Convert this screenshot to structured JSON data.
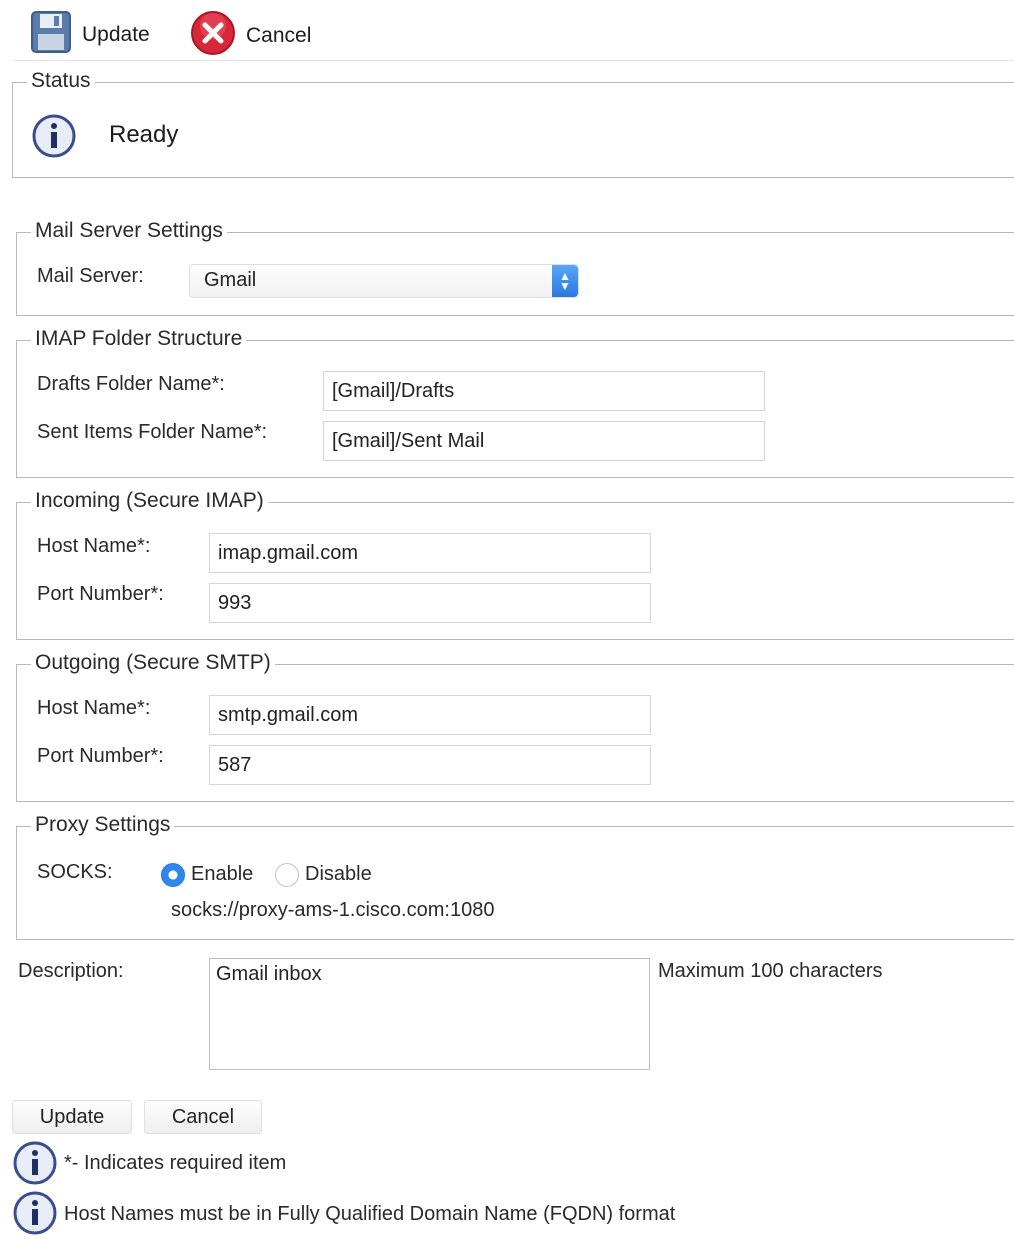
{
  "toolbar": {
    "update_label": "Update",
    "cancel_label": "Cancel"
  },
  "status": {
    "legend": "Status",
    "text": "Ready"
  },
  "mail_server_settings": {
    "legend": "Mail Server Settings",
    "mail_server_label": "Mail Server:",
    "mail_server_value": "Gmail"
  },
  "imap_folder_structure": {
    "legend": "IMAP Folder Structure",
    "drafts_label": "Drafts Folder Name*:",
    "drafts_value": "[Gmail]/Drafts",
    "sent_label": "Sent Items Folder Name*:",
    "sent_value": "[Gmail]/Sent Mail"
  },
  "incoming": {
    "legend": "Incoming (Secure IMAP)",
    "host_label": "Host Name*:",
    "host_value": "imap.gmail.com",
    "port_label": "Port Number*:",
    "port_value": "993"
  },
  "outgoing": {
    "legend": "Outgoing (Secure SMTP)",
    "host_label": "Host Name*:",
    "host_value": "smtp.gmail.com",
    "port_label": "Port Number*:",
    "port_value": "587"
  },
  "proxy": {
    "legend": "Proxy Settings",
    "socks_label": "SOCKS:",
    "enable_label": "Enable",
    "disable_label": "Disable",
    "selected": "Enable",
    "proxy_url": "socks://proxy-ams-1.cisco.com:1080"
  },
  "description": {
    "label": "Description:",
    "value": "Gmail inbox",
    "hint": "Maximum 100 characters"
  },
  "bottom_buttons": {
    "update_label": "Update",
    "cancel_label": "Cancel"
  },
  "notes": {
    "required": "*- Indicates required item",
    "fqdn": "Host Names must be in Fully Qualified Domain Name (FQDN) format"
  },
  "colors": {
    "radio_accent": "#2f86ee",
    "cancel_icon": "#d8263a",
    "info_icon": "#3a4e8c"
  }
}
